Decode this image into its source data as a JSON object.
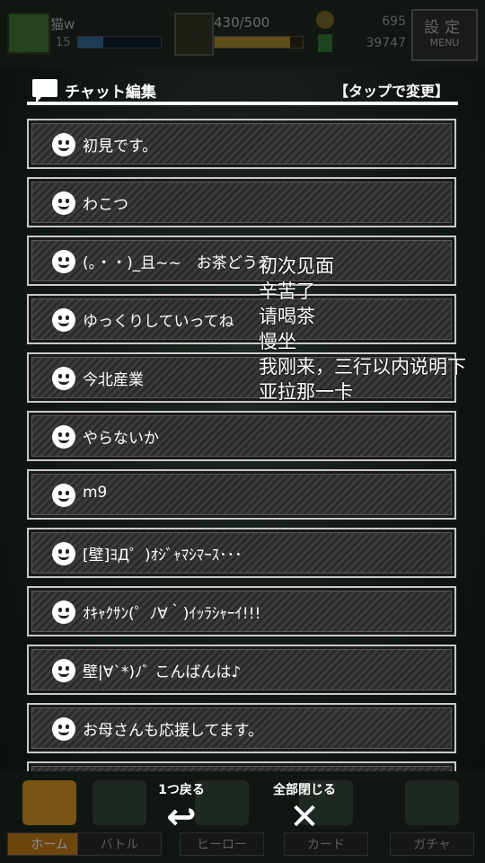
{
  "status_bar": {
    "player_name": "猫w",
    "level": "15",
    "stamina": "430/500",
    "coins": "695",
    "gems": "39747",
    "settings_label": "設定",
    "menu_label": "MENU"
  },
  "panel": {
    "title": "チャット編集",
    "hint": "【タップで変更】"
  },
  "chat_items": [
    "初見です。",
    "わこつ",
    "(。・・)_且~~　お茶どうぞ",
    "ゆっくりしていってね",
    "今北産業",
    "やらないか",
    "m9",
    "[壁]ﾖД゜)ｵｼﾞｬﾏｼﾏｰｽ･･･",
    "ｵｷｬｸｻﾝ(゜ﾉ∀｀)ｲｯﾗｼｬｰｲ!!!",
    "壁|∀`*)ﾉﾞ こんばんは♪",
    "お母さんも応援してます。",
    ""
  ],
  "annotation_lines": [
    "初次见面",
    "辛苦了",
    "请喝茶",
    "慢坐",
    "我刚来，三行以内说明下",
    "亚拉那一卡"
  ],
  "actions": {
    "back_label": "1つ戻る",
    "back_icon": "↩",
    "close_all_label": "全部閉じる",
    "close_icon": "✕"
  },
  "bottom_nav": [
    {
      "label": "ホーム",
      "icon": "home-icon"
    },
    {
      "label": "バトル",
      "icon": "battle-icon"
    },
    {
      "label": "ヒーロー",
      "icon": "hero-icon"
    },
    {
      "label": "カード",
      "icon": "card-icon"
    },
    {
      "label": "ガチャ",
      "icon": "gacha-icon"
    }
  ],
  "colors": {
    "item_border": "#c8c8c8",
    "home_accent": "#d99a20"
  }
}
